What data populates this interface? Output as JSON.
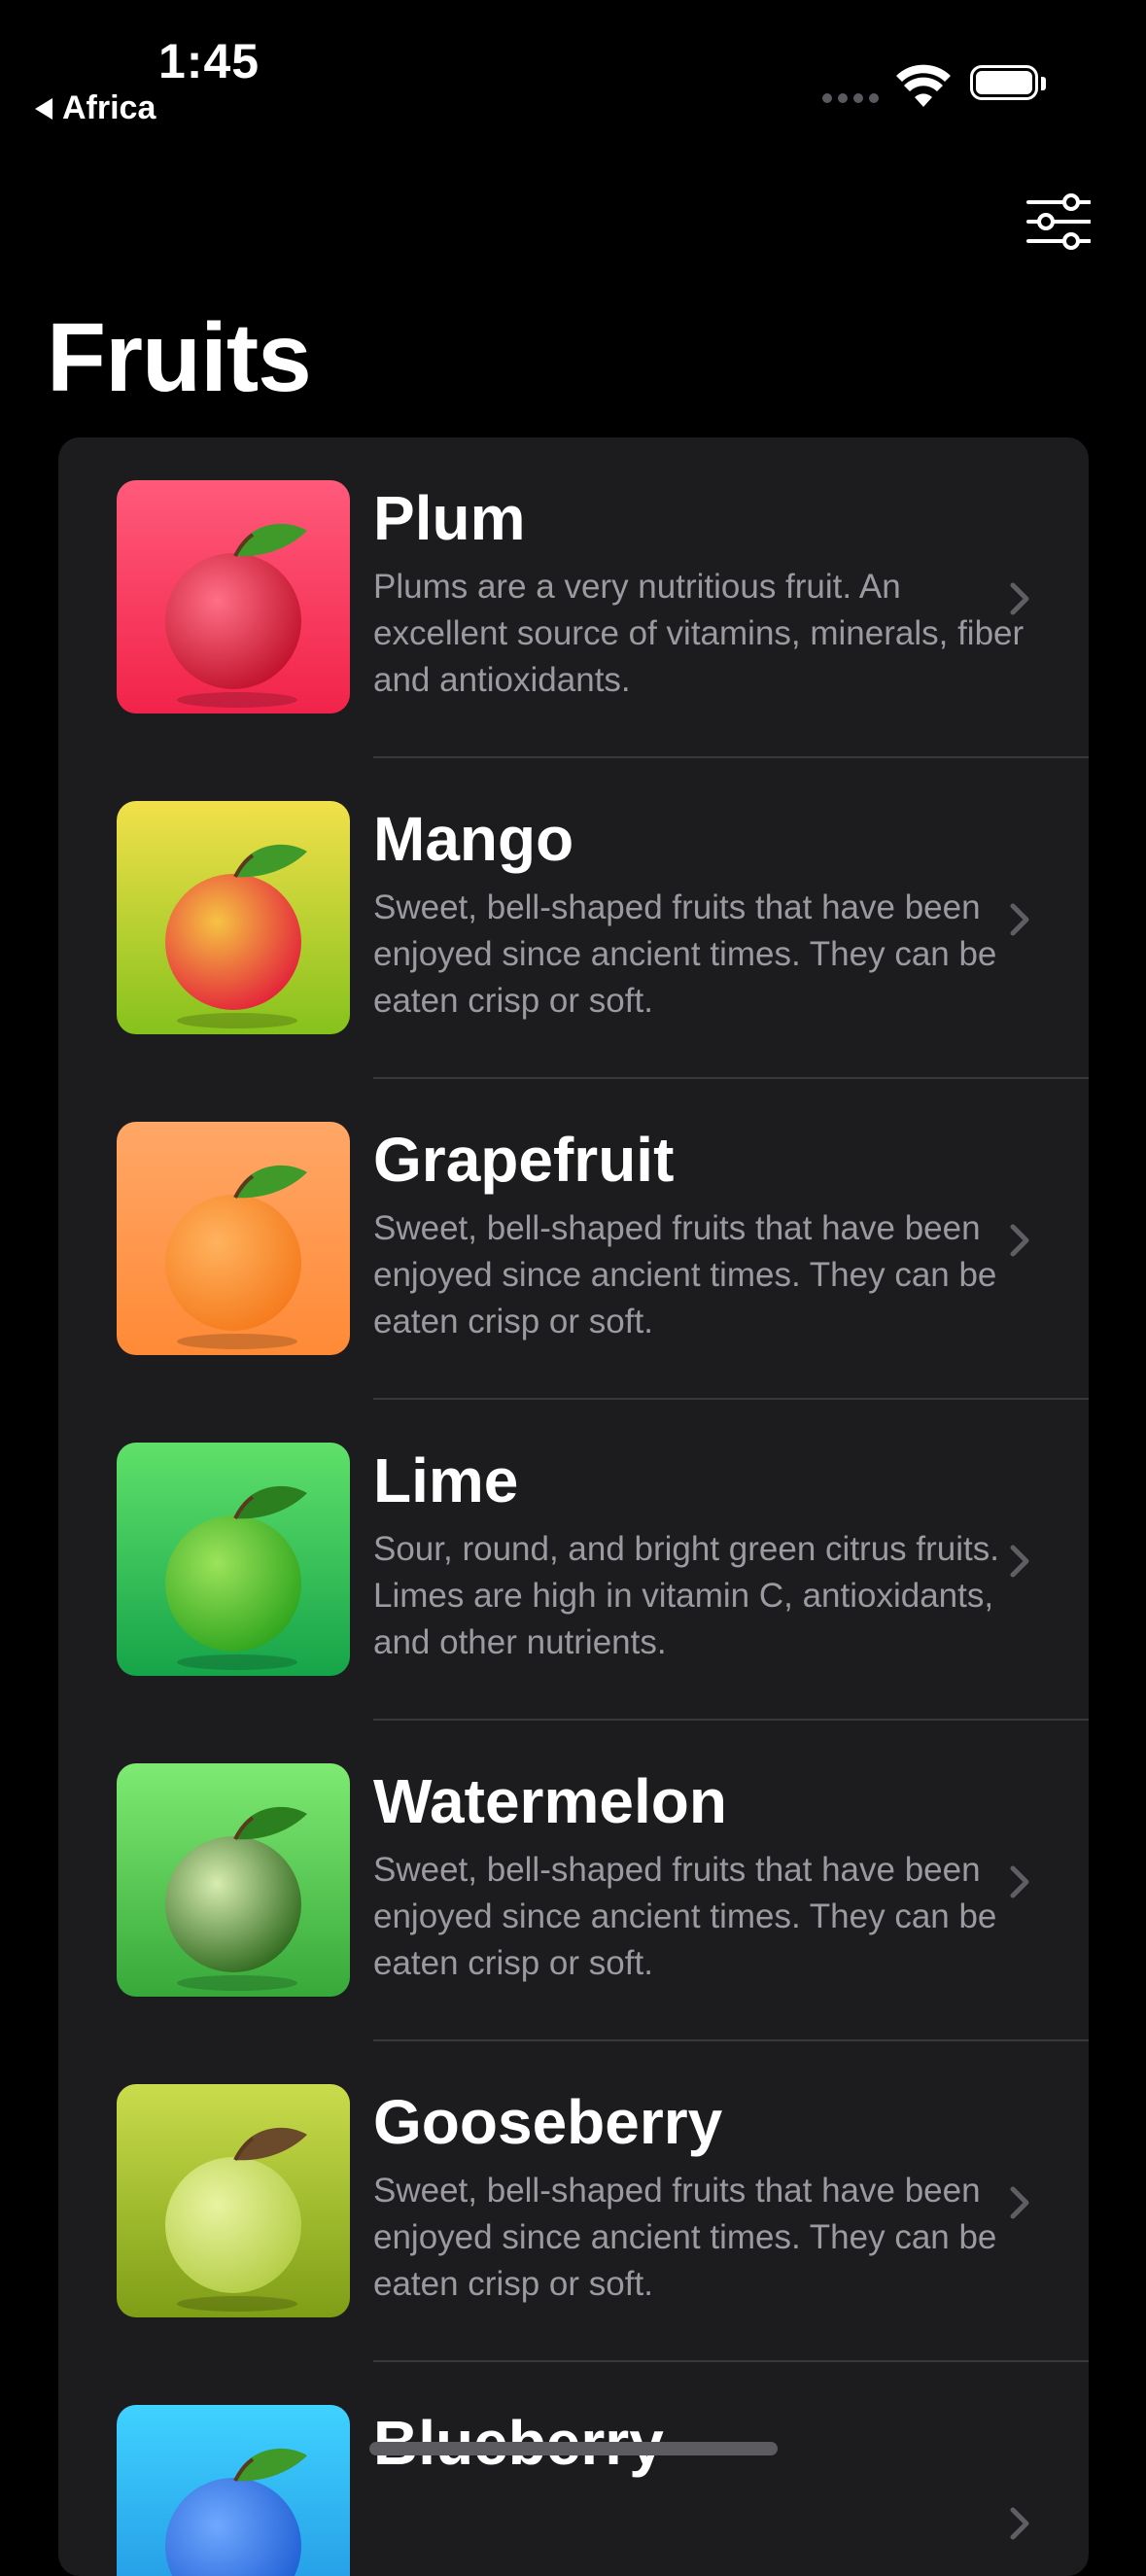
{
  "status_bar": {
    "time": "1:45",
    "back_label": "Africa"
  },
  "nav": {
    "title": "Fruits",
    "filter_icon": "sliders-icon"
  },
  "fruits": [
    {
      "name": "Plum",
      "description": "Plums are a very nutritious fruit. An excellent source of vitamins, minerals, fiber and antioxidants.",
      "bg_top": "#ff5a7a",
      "bg_bottom": "#f2234a",
      "fruit": "#c1122c",
      "fruit_hl": "#ff6f86",
      "leaf": "#3f9a2a"
    },
    {
      "name": "Mango",
      "description": "Sweet, bell-shaped fruits that have been enjoyed since ancient times. They can be eaten crisp or soft.",
      "bg_top": "#f2e04a",
      "bg_bottom": "#86c21c",
      "fruit": "#e3233a",
      "fruit_hl": "#f6c343",
      "leaf": "#3f9a2a"
    },
    {
      "name": "Grapefruit",
      "description": "Sweet, bell-shaped fruits that have been enjoyed since ancient times. They can be eaten crisp or soft.",
      "bg_top": "#ffa767",
      "bg_bottom": "#ff8a36",
      "fruit": "#f57b1d",
      "fruit_hl": "#ffb25e",
      "leaf": "#3f9a2a"
    },
    {
      "name": "Lime",
      "description": "Sour, round, and bright green citrus fruits. Limes are high in vitamin C, antioxidants, and other nutrients.",
      "bg_top": "#5fe06a",
      "bg_bottom": "#16a44a",
      "fruit": "#2fa51e",
      "fruit_hl": "#9be35a",
      "leaf": "#2c7f1e"
    },
    {
      "name": "Watermelon",
      "description": "Sweet, bell-shaped fruits that have been enjoyed since ancient times. They can be eaten crisp or soft.",
      "bg_top": "#7eea72",
      "bg_bottom": "#37a93a",
      "fruit": "#2f6a1e",
      "fruit_hl": "#d7ecb0",
      "leaf": "#2c7f1e"
    },
    {
      "name": "Gooseberry",
      "description": "Sweet, bell-shaped fruits that have been enjoyed since ancient times. They can be eaten crisp or soft.",
      "bg_top": "#c9dc4c",
      "bg_bottom": "#7e9e16",
      "fruit": "#b4cd46",
      "fruit_hl": "#e8f3a0",
      "leaf": "#6a4a2a"
    },
    {
      "name": "Blueberry",
      "description": "",
      "bg_top": "#3fd2ff",
      "bg_bottom": "#1e8fe0",
      "fruit": "#1f5fd4",
      "fruit_hl": "#6fa8ff",
      "leaf": "#3f9a2a"
    }
  ]
}
